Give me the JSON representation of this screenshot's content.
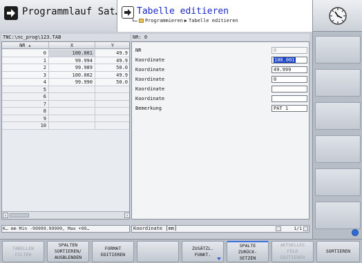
{
  "header": {
    "mode_left_title": "Programmlauf Sat…",
    "mode_right_title": "Tabelle editieren",
    "breadcrumb_a": "Programmieren",
    "breadcrumb_sep": "▶",
    "breadcrumb_b": "Tabelle editieren"
  },
  "table": {
    "path": "TNC:\\nc_prog\\123.TAB",
    "columns": [
      "NR",
      "X",
      "Y"
    ],
    "rows": [
      {
        "nr": "0",
        "x": "100.001",
        "y": "49.9"
      },
      {
        "nr": "1",
        "x": "99.994",
        "y": "49.9"
      },
      {
        "nr": "2",
        "x": "99.989",
        "y": "50.0"
      },
      {
        "nr": "3",
        "x": "100.002",
        "y": "49.9"
      },
      {
        "nr": "4",
        "x": "99.990",
        "y": "50.0"
      },
      {
        "nr": "5",
        "x": "",
        "y": ""
      },
      {
        "nr": "6",
        "x": "",
        "y": ""
      },
      {
        "nr": "7",
        "x": "",
        "y": ""
      },
      {
        "nr": "8",
        "x": "",
        "y": ""
      },
      {
        "nr": "9",
        "x": "",
        "y": ""
      },
      {
        "nr": "10",
        "x": "",
        "y": ""
      }
    ],
    "status": "K… mm Min -99999.99999, Max +99…"
  },
  "editor": {
    "nr_header": "NR: 0",
    "fields": [
      {
        "label": "NR",
        "value": "0"
      },
      {
        "label": "Koordinate",
        "value": "100.001"
      },
      {
        "label": "Koordinate",
        "value": "49.999"
      },
      {
        "label": "Koordinate",
        "value": "0"
      },
      {
        "label": "Koordinate",
        "value": ""
      },
      {
        "label": "Koordinate",
        "value": ""
      },
      {
        "label": "Bemerkung",
        "value": "PAT 1"
      }
    ],
    "status": "Koordinate [mm]",
    "page": "1/1"
  },
  "softkeys": [
    {
      "line1": "TABELLEN",
      "line2": "FILTER",
      "line3": ""
    },
    {
      "line1": "SPALTEN",
      "line2": "SORTIEREN/",
      "line3": "AUSBLENDEN"
    },
    {
      "line1": "FORMAT",
      "line2": "EDITIEREN",
      "line3": ""
    },
    {
      "line1": "",
      "line2": "",
      "line3": ""
    },
    {
      "line1": "ZUSÄTZL.",
      "line2": "FUNKT.",
      "line3": ""
    },
    {
      "line1": "SPALTE",
      "line2": "ZURÜCK-",
      "line3": "SETZEN"
    },
    {
      "line1": "AKTUELLES",
      "line2": "FELD",
      "line3": "EDITIEREN"
    },
    {
      "line1": "SORTIEREN",
      "line2": "",
      "line3": ""
    }
  ],
  "colors": {
    "accent": "#1a28c8",
    "selection": "#1a42c8",
    "softkey_indicator": "#2d5ed0"
  },
  "icons": [
    "run-mode-arrow-icon",
    "edit-mode-arrow-icon",
    "folder-icon",
    "clock-icon",
    "info-icon",
    "dropdown-triangle-icon"
  ]
}
